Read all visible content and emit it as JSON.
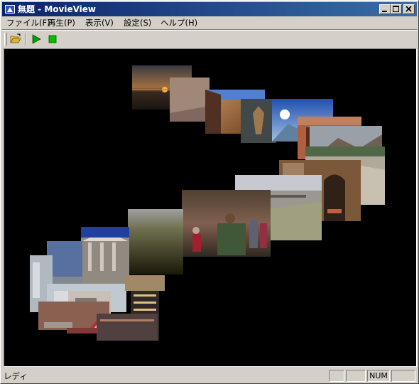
{
  "window": {
    "title": "無題 - MovieView"
  },
  "menu": {
    "items": [
      {
        "label": "ファイル(F)"
      },
      {
        "label": "再生(P)"
      },
      {
        "label": "表示(V)"
      },
      {
        "label": "設定(S)"
      },
      {
        "label": "ヘルプ(H)"
      }
    ]
  },
  "toolbar": {
    "buttons": [
      {
        "icon": "open-folder-icon"
      },
      {
        "icon": "play-icon"
      },
      {
        "icon": "stop-icon"
      }
    ]
  },
  "status": {
    "text": "レディ",
    "panes": [
      "",
      "",
      "NUM",
      ""
    ]
  },
  "colors": {
    "titlebar_start": "#0a246a",
    "titlebar_end": "#3a6ea5",
    "viewport_bg": "#000000",
    "play_green": "#00a000"
  }
}
